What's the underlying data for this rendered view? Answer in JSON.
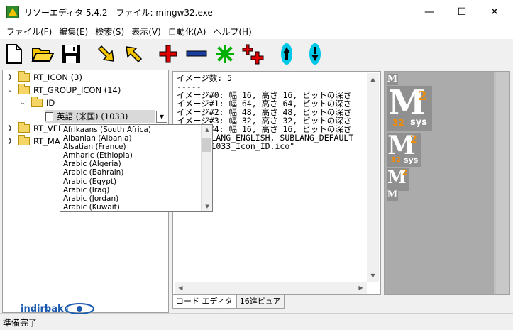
{
  "window": {
    "title": "リソーエディタ 5.4.2 - ファイル: mingw32.exe",
    "minimize": "—",
    "maximize": "☐",
    "close": "✕"
  },
  "menu": [
    "ファイル(F)",
    "編集(E)",
    "検索(S)",
    "表示(V)",
    "自動化(A)",
    "ヘルプ(H)"
  ],
  "toolbar": [
    {
      "name": "new-file-icon"
    },
    {
      "name": "open-folder-icon"
    },
    {
      "name": "save-icon"
    },
    {
      "name": "arrow-down-right-icon"
    },
    {
      "name": "arrow-up-left-icon"
    },
    {
      "name": "add-icon"
    },
    {
      "name": "remove-icon"
    },
    {
      "name": "star-icon"
    },
    {
      "name": "clone-icon"
    },
    {
      "name": "move-up-icon"
    },
    {
      "name": "move-down-icon"
    }
  ],
  "tree": {
    "items": [
      {
        "label": "RT_ICON (3)",
        "expanded": false
      },
      {
        "label": "RT_GROUP_ICON (14)",
        "expanded": true
      },
      {
        "label": "ID",
        "expanded": true
      },
      {
        "label": "英語 (米国) (1033)",
        "selected": true
      },
      {
        "label": "RT_VER",
        "expanded": false
      },
      {
        "label": "RT_MA",
        "expanded": false
      }
    ]
  },
  "language_dropdown": {
    "options": [
      "Afrikaans (South Africa)",
      "Albanian (Albania)",
      "Alsatian (France)",
      "Amharic (Ethiopia)",
      "Arabic (Algeria)",
      "Arabic (Bahrain)",
      "Arabic (Egypt)",
      "Arabic (Iraq)",
      "Arabic (Jordan)",
      "Arabic (Kuwait)"
    ]
  },
  "code": {
    "lines": [
      "イメージ数: 5",
      "-----",
      "イメージ#0: 幅 16, 高さ 16, ビットの深さ",
      "イメージ#1: 幅 64, 高さ 64, ビットの深さ",
      "イメージ#2: 幅 48, 高さ 48, ビットの深さ",
      "イメージ#3: 幅 32, 高さ 32, ビットの深さ",
      "イメージ#4: 幅 16, 高さ 16, ビットの深さ",
      "",
      "       LANG_ENGLISH, SUBLANG_DEFAULT",
      "",
      "      \"1033_Icon_ID.ico\""
    ]
  },
  "tabs": [
    "コード エディタ",
    "16進ビュア"
  ],
  "preview": {
    "icon_text": "M",
    "icon_number": "2",
    "icon_bits": "32",
    "icon_sys": "sys"
  },
  "status": {
    "text": "準備完了",
    "watermark": "indirbak"
  },
  "colors": {
    "accent_red": "#e00000",
    "accent_blue": "#1a3da0",
    "accent_green": "#00b000",
    "arrow_yellow": "#f5c400",
    "cyan": "#00c8e8"
  }
}
